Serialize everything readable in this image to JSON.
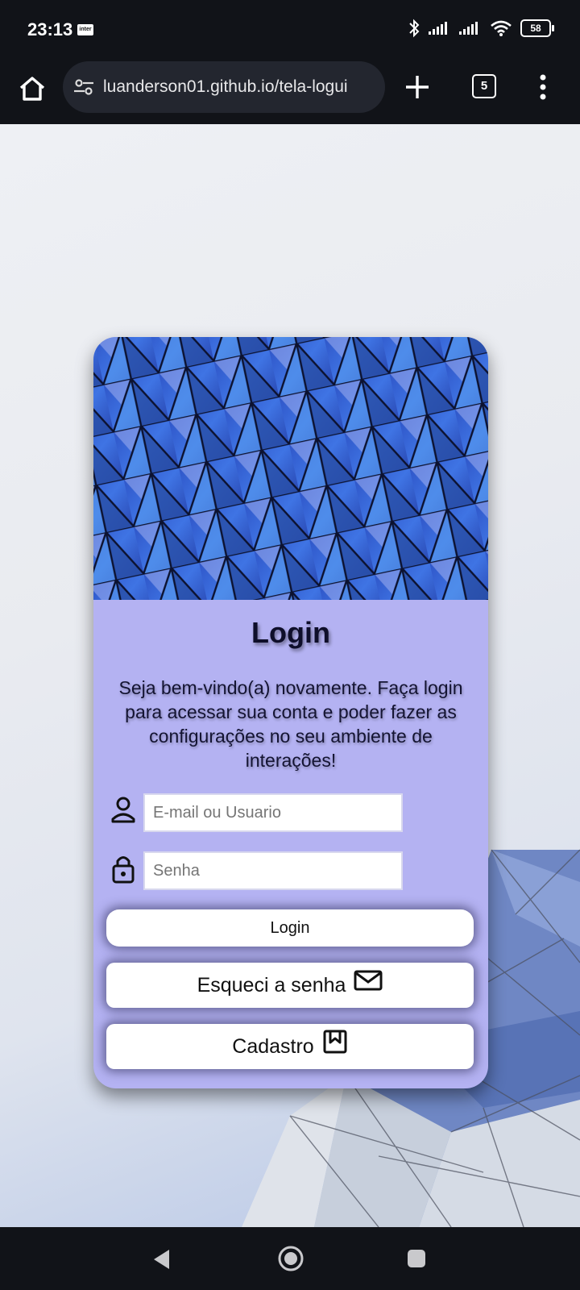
{
  "status_bar": {
    "time": "23:13",
    "carrier_icon": "inter",
    "battery": "58",
    "icons": [
      "bluetooth-icon",
      "signal-icon",
      "signal-icon",
      "wifi-icon",
      "battery-icon"
    ]
  },
  "browser": {
    "url": "luanderson01.github.io/tela-logui",
    "tab_count": "5"
  },
  "login_card": {
    "title": "Login",
    "description": "Seja bem-vindo(a) novamente. Faça login para acessar sua conta e poder fazer as configurações no seu ambiente de interações!",
    "user_placeholder": "E-mail ou Usuario",
    "password_placeholder": "Senha",
    "login_button": "Login",
    "forgot_button": "Esqueci a senha",
    "signup_button": "Cadastro"
  },
  "colors": {
    "card_background": "#b4b2f2",
    "chrome_background": "#111318",
    "url_box": "#23262f"
  }
}
